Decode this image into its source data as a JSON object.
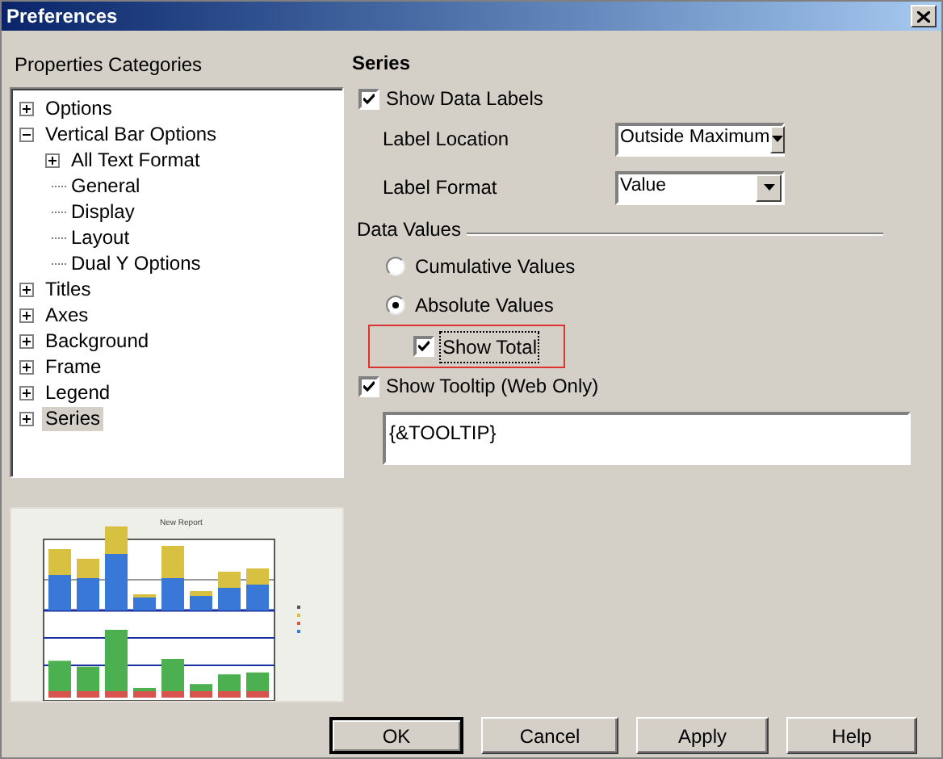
{
  "window": {
    "title": "Preferences"
  },
  "categories": {
    "heading": "Properties Categories",
    "tree": [
      {
        "label": "Options",
        "kind": "branch",
        "expanded": false,
        "selected": false
      },
      {
        "label": "Vertical Bar Options",
        "kind": "branch",
        "expanded": true,
        "selected": false,
        "children": [
          {
            "label": "All Text Format",
            "kind": "branch",
            "expanded": false,
            "selected": false
          },
          {
            "label": "General",
            "kind": "leaf",
            "selected": false
          },
          {
            "label": "Display",
            "kind": "leaf",
            "selected": false
          },
          {
            "label": "Layout",
            "kind": "leaf",
            "selected": false
          },
          {
            "label": "Dual Y Options",
            "kind": "leaf",
            "selected": false
          }
        ]
      },
      {
        "label": "Titles",
        "kind": "branch",
        "expanded": false,
        "selected": false
      },
      {
        "label": "Axes",
        "kind": "branch",
        "expanded": false,
        "selected": false
      },
      {
        "label": "Background",
        "kind": "branch",
        "expanded": false,
        "selected": false
      },
      {
        "label": "Frame",
        "kind": "branch",
        "expanded": false,
        "selected": false
      },
      {
        "label": "Legend",
        "kind": "branch",
        "expanded": false,
        "selected": false
      },
      {
        "label": "Series",
        "kind": "branch",
        "expanded": false,
        "selected": true
      }
    ]
  },
  "preview": {
    "title": "New Report"
  },
  "series": {
    "heading": "Series",
    "show_data_labels": {
      "label": "Show Data Labels",
      "checked": true
    },
    "label_location": {
      "label": "Label Location",
      "value": "Outside Maximum"
    },
    "label_format": {
      "label": "Label Format",
      "value": "Value"
    },
    "data_values": {
      "label": "Data Values",
      "options": [
        {
          "label": "Cumulative Values",
          "selected": false
        },
        {
          "label": "Absolute Values",
          "selected": true
        }
      ]
    },
    "show_total": {
      "label": "Show Total",
      "checked": true,
      "highlighted": true
    },
    "show_tooltip": {
      "label": "Show Tooltip (Web Only)",
      "checked": true
    },
    "tooltip_text": "{&TOOLTIP}"
  },
  "buttons": [
    {
      "label": "OK",
      "default": true
    },
    {
      "label": "Cancel",
      "default": false
    },
    {
      "label": "Apply",
      "default": false
    },
    {
      "label": "Help",
      "default": false
    }
  ]
}
